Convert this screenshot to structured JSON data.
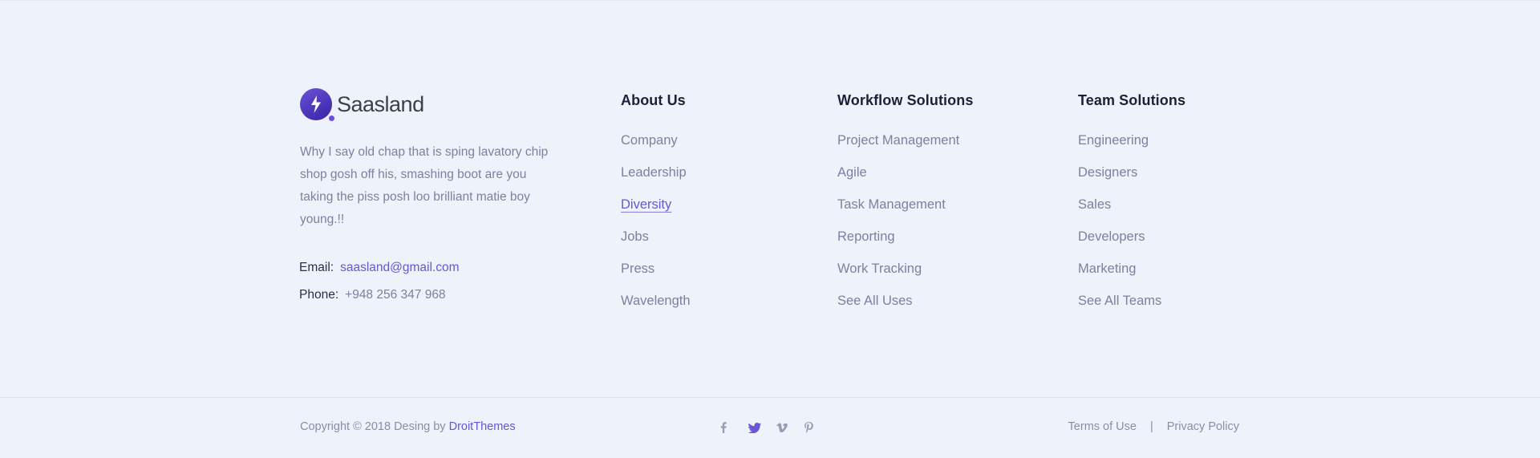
{
  "brand": {
    "name": "Saasland",
    "description": "Why I say old chap that is sping lavatory chip shop gosh off his, smashing boot are you taking the piss posh loo brilliant matie boy young.!!"
  },
  "contact": {
    "email_label": "Email:",
    "email": "saasland@gmail.com",
    "phone_label": "Phone:",
    "phone": "+948 256 347 968"
  },
  "columns": [
    {
      "title": "About Us",
      "items": [
        "Company",
        "Leadership",
        "Diversity",
        "Jobs",
        "Press",
        "Wavelength"
      ]
    },
    {
      "title": "Workflow Solutions",
      "items": [
        "Project Management",
        "Agile",
        "Task Management",
        "Reporting",
        "Work Tracking",
        "See All Uses"
      ]
    },
    {
      "title": "Team Solutions",
      "items": [
        "Engineering",
        "Designers",
        "Sales",
        "Developers",
        "Marketing",
        "See All Teams"
      ]
    }
  ],
  "bottom": {
    "copyright_prefix": "Copyright © 2018 Desing by ",
    "copyright_link": "DroitThemes",
    "terms": "Terms of Use",
    "separator": "|",
    "privacy": "Privacy Policy"
  },
  "social": [
    "facebook-icon",
    "twitter-icon",
    "vimeo-icon",
    "pinterest-icon"
  ],
  "colors": {
    "background": "#eef2fa",
    "accent": "#6a55d6",
    "heading": "#1e2038",
    "text": "#7d80a0"
  }
}
